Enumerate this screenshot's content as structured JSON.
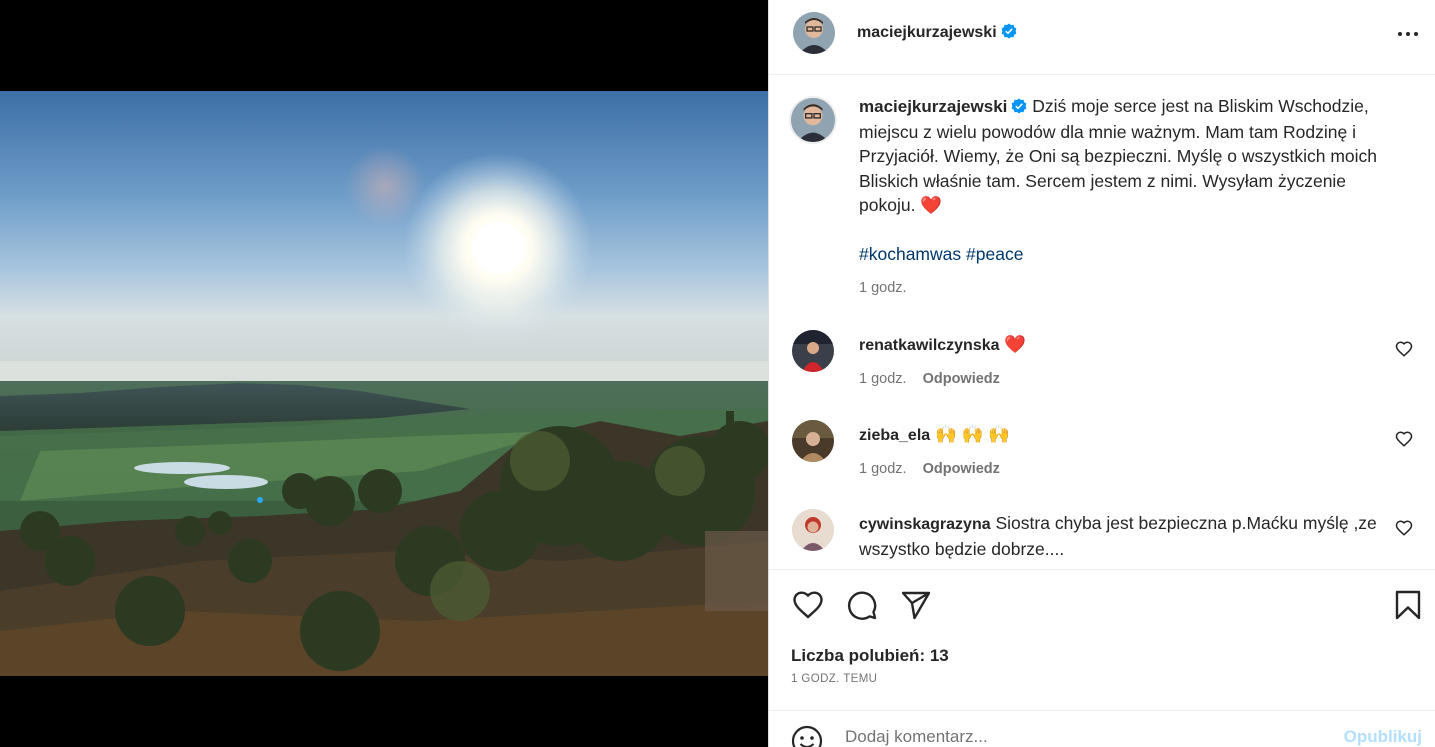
{
  "colors": {
    "link": "#00376b",
    "muted": "#737373",
    "verified": "#0095f6",
    "publish_disabled": "#b2dffc",
    "heart": "#ed1c24"
  },
  "header": {
    "username": "maciejkurzajewski",
    "more_icon": "more-horizontal-icon"
  },
  "caption": {
    "username": "maciejkurzajewski",
    "text": "Dziś moje serce jest na Bliskim Wschodzie, miejscu z wielu powodów dla mnie ważnym. Mam tam Rodzinę i Przyjaciół. Wiemy, że Oni są bezpieczni. Myślę o wszystkich moich Bliskich właśnie tam. Sercem jestem z nimi. Wysyłam życzenie pokoju.",
    "emoji": "❤️",
    "hashtags": [
      "#kochamwas",
      "#peace"
    ],
    "time": "1 godz."
  },
  "comments": [
    {
      "username": "renatkawilczynska",
      "text": "❤️",
      "time": "1 godz.",
      "reply": "Odpowiedz"
    },
    {
      "username": "zieba_ela",
      "text": "🙌 🙌 🙌",
      "time": "1 godz.",
      "reply": "Odpowiedz"
    },
    {
      "username": "cywinskagrazyna",
      "text": "Siostra chyba jest bezpieczna p.Maćku myślę ,ze wszystko będzie dobrze...."
    }
  ],
  "actions": {
    "likes": "Liczba polubień: 13",
    "date": "1 GODZ. TEMU"
  },
  "add_comment": {
    "placeholder": "Dodaj komentarz...",
    "publish": "Opublikuj"
  }
}
